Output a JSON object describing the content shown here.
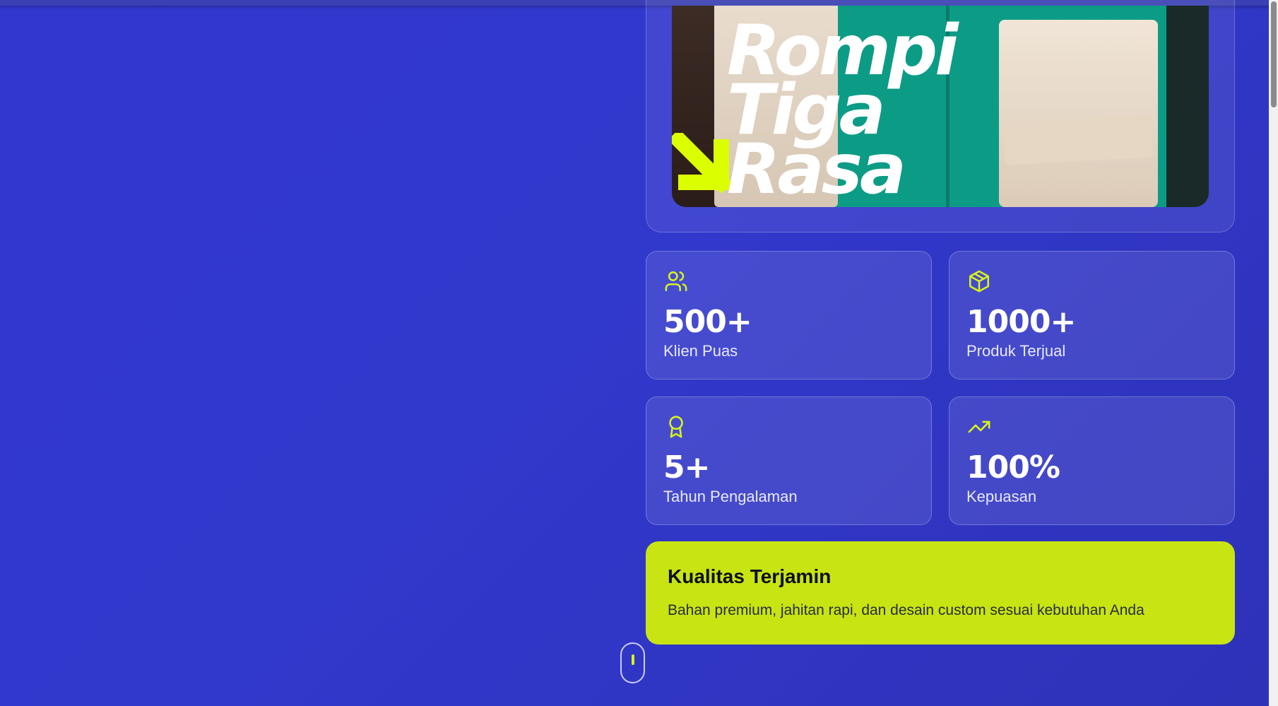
{
  "hero_image": {
    "caption_lines": [
      "Rompi",
      "Tiga",
      "Rasa"
    ]
  },
  "stats": [
    {
      "icon": "users-icon",
      "value": "500+",
      "label": "Klien Puas"
    },
    {
      "icon": "package-icon",
      "value": "1000+",
      "label": "Produk Terjual"
    },
    {
      "icon": "award-icon",
      "value": "5+",
      "label": "Tahun Pengalaman"
    },
    {
      "icon": "trending-up-icon",
      "value": "100%",
      "label": "Kepuasan"
    }
  ],
  "quality": {
    "title": "Kualitas Terjamin",
    "description": "Bahan premium, jahitan rapi, dan desain custom sesuai kebutuhan Anda"
  },
  "colors": {
    "background": "#3237d0",
    "accent": "#c8e413",
    "icon": "#d7f41a"
  }
}
